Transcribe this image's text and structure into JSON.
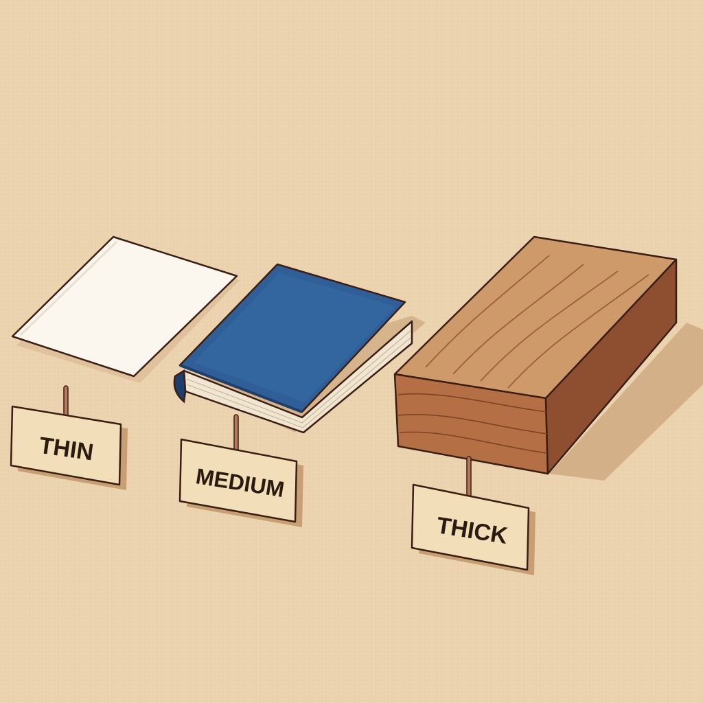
{
  "colors": {
    "background": "#ecd3b0",
    "paper": "#fbf6ee",
    "book_cover": "#2f5f96",
    "book_pages": "#f1e6d2",
    "wood_top": "#cf9a6a",
    "wood_side": "#b56f45",
    "wood_dark": "#8e4f31",
    "tag_fill": "#f2dfb9",
    "tag_shadow": "#c79f73",
    "outline": "#3a1e14",
    "stick": "#b57a5a"
  },
  "items": [
    {
      "object": "sheet-of-paper",
      "label": "THIN"
    },
    {
      "object": "book",
      "label": "MEDIUM"
    },
    {
      "object": "block-of-wood",
      "label": "THICK"
    }
  ]
}
